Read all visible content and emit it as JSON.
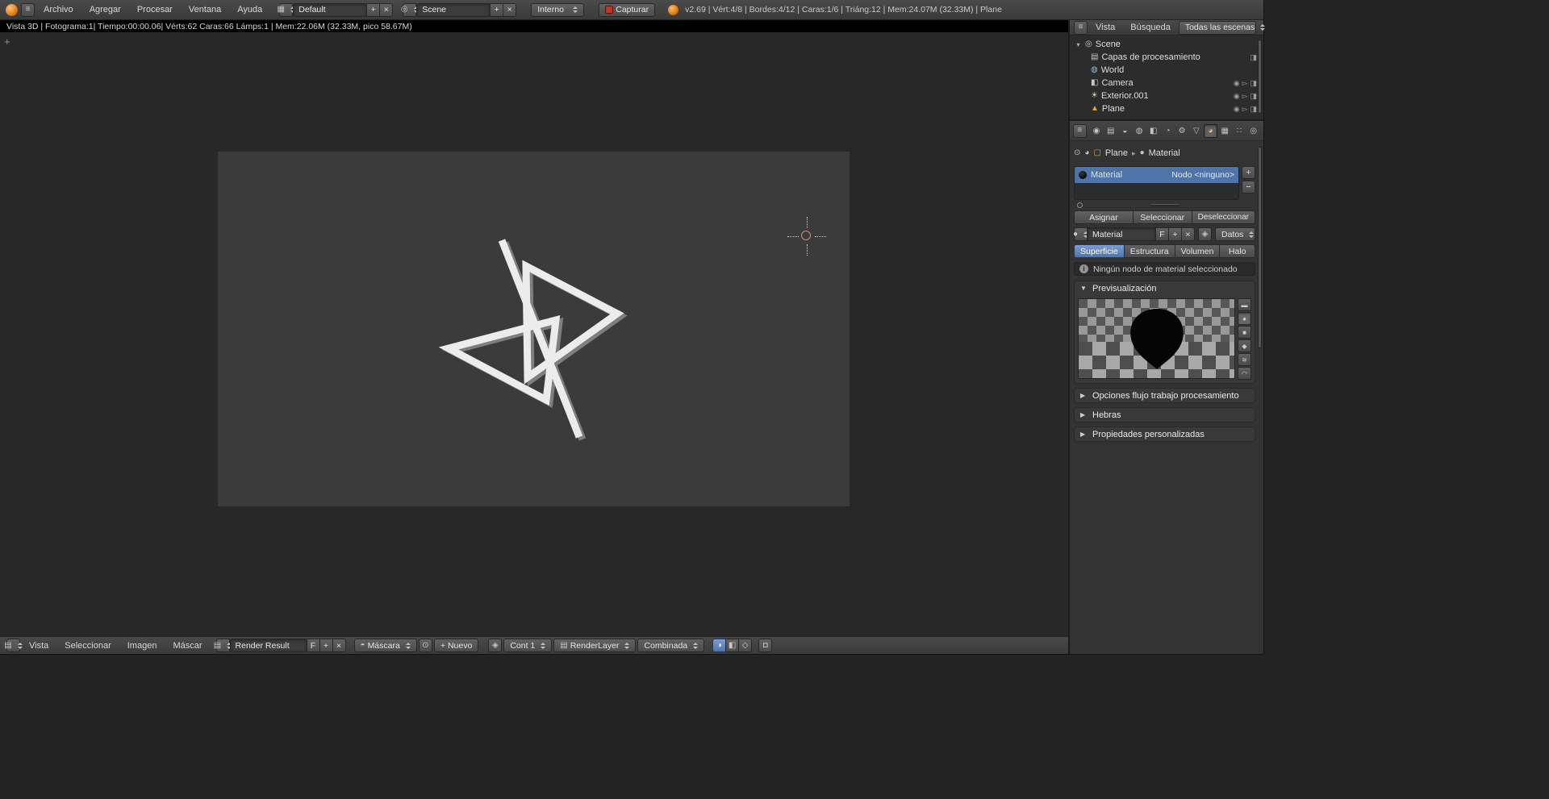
{
  "colors": {
    "accent_blue": "#5680c2",
    "selected_row": "#4f74a7",
    "active_object_orange": "#e8a33e",
    "record_red": "#c2342a"
  },
  "icons": {
    "plus": "+",
    "close": "×",
    "minus": "−",
    "chevron_right": "▸",
    "panel_open": "▼",
    "panel_closed": "▶",
    "expander": "▾",
    "editor_info": "≡",
    "grid": "▦",
    "scene": "◎",
    "image": "▤",
    "mask": "◓",
    "pin": "⊙",
    "display": "◈",
    "rgb": "◑",
    "alpha": "◧",
    "mask_edit": "◇",
    "lock": "◘",
    "eye": "◉",
    "arrow": "▻",
    "cam_toggle": "◨",
    "sphere": "●",
    "cube": "▢",
    "info": "i",
    "material_sphere": "◕"
  },
  "topbar": {
    "menus": [
      "Archivo",
      "Agregar",
      "Procesar",
      "Ventana",
      "Ayuda"
    ],
    "layout_name": "Default",
    "scene_name": "Scene",
    "engine": "Interno",
    "capture_label": "Capturar",
    "stats": "v2.69 | Vért:4/8 | Bordes:4/12 | Caras:1/6 | Triáng:12 | Mem:24.07M (32.33M) | Plane"
  },
  "render_bar": {
    "text": "Vista 3D | Fotograma:1| Tiempo:00:00.06| Vérts:62 Caras:66 Lámps:1 | Mem:22.06M (32.33M, pico 58.67M)"
  },
  "image_header": {
    "menus": [
      "Vista",
      "Seleccionar",
      "Imagen",
      "Máscar"
    ],
    "image_name": "Render Result",
    "fake_user": "F",
    "mask_name": "Máscara",
    "new_label": "Nuevo",
    "slot": "Cont 1",
    "layer": "RenderLayer",
    "pass": "Combinada"
  },
  "outliner": {
    "menu_view": "Vista",
    "menu_search": "Búsqueda",
    "display_mode": "Todas las escenas",
    "items": [
      {
        "label": "Scene",
        "icon": "◎"
      },
      {
        "label": "Capas de procesamiento",
        "icon": "▤"
      },
      {
        "label": "World",
        "icon": "◍"
      },
      {
        "label": "Camera",
        "icon": "◧"
      },
      {
        "label": "Exterior.001",
        "icon": "☀"
      },
      {
        "label": "Plane",
        "icon": "▲"
      }
    ]
  },
  "properties": {
    "prop_tabs": [
      {
        "name": "render",
        "glyph": "◉"
      },
      {
        "name": "render-layers",
        "glyph": "▤"
      },
      {
        "name": "scene",
        "glyph": "◒"
      },
      {
        "name": "world",
        "glyph": "◍"
      },
      {
        "name": "object",
        "glyph": "◧"
      },
      {
        "name": "constraints",
        "glyph": "◔"
      },
      {
        "name": "modifiers",
        "glyph": "⚙"
      },
      {
        "name": "object-data",
        "glyph": "▽"
      },
      {
        "name": "material",
        "glyph": "◕"
      },
      {
        "name": "texture",
        "glyph": "▦"
      },
      {
        "name": "particles",
        "glyph": "∷"
      },
      {
        "name": "physics",
        "glyph": "◎"
      }
    ],
    "breadcrumb_object": "Plane",
    "breadcrumb_context": "Material",
    "slot_name": "Material",
    "slot_node": "Nodo <ninguno>",
    "assign": "Asignar",
    "select": "Seleccionar",
    "deselect": "Deseleccionar",
    "datablock_name": "Material",
    "fake_user": "F",
    "link_mode": "Datos",
    "tabs": [
      "Superficie",
      "Estructura",
      "Volumen",
      "Halo"
    ],
    "notice": "Ningún nodo de material seleccionado",
    "panels": {
      "preview": "Previsualización",
      "options": "Opciones flujo trabajo procesamiento",
      "threads": "Hebras",
      "custom": "Propiedades personalizadas"
    },
    "preview_buttons": [
      {
        "name": "flat",
        "glyph": "▬"
      },
      {
        "name": "sphere",
        "glyph": "●"
      },
      {
        "name": "cube",
        "glyph": "■"
      },
      {
        "name": "monkey",
        "glyph": "◆"
      },
      {
        "name": "hair",
        "glyph": "≋"
      },
      {
        "name": "sky",
        "glyph": "◠"
      }
    ]
  }
}
